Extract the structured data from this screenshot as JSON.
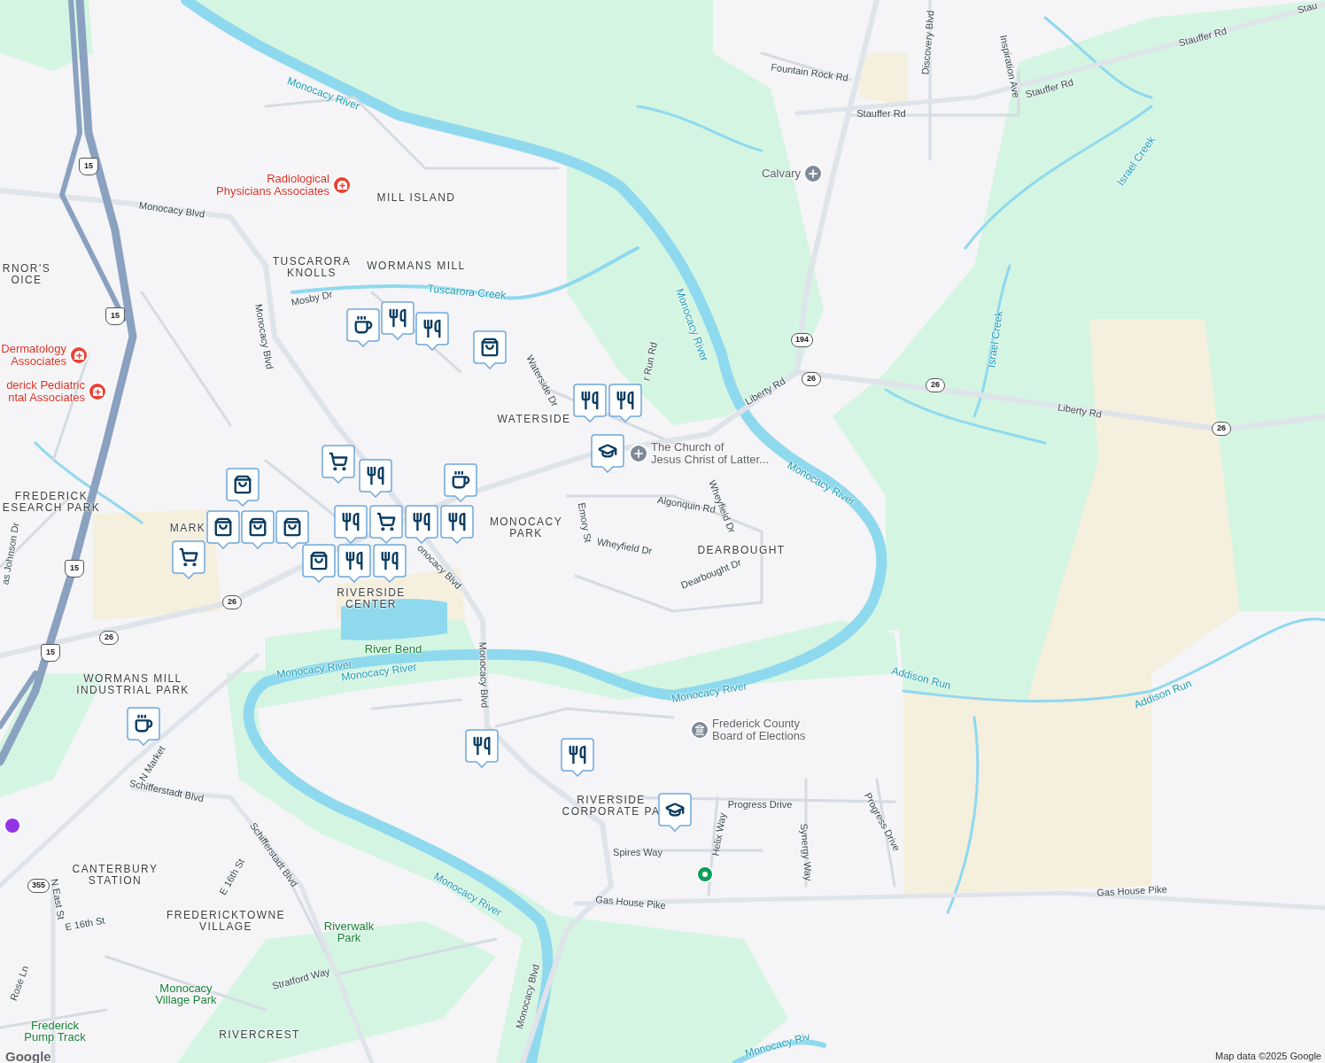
{
  "labels": [
    {
      "kind": "area",
      "text": "MILL ISLAND"
    },
    {
      "kind": "area",
      "text": "RNOR'S\nOICE"
    },
    {
      "kind": "area",
      "text": "TUSCARORA\nKNOLLS"
    },
    {
      "kind": "area",
      "text": "WORMANS MILL"
    },
    {
      "kind": "area",
      "text": "WATERSIDE"
    },
    {
      "kind": "area",
      "text": "FREDERICK\nESEARCH PARK"
    },
    {
      "kind": "area",
      "text": "MARK"
    },
    {
      "kind": "area",
      "text": "MONOCACY\nPARK"
    },
    {
      "kind": "area",
      "text": "DEARBOUGHT"
    },
    {
      "kind": "area",
      "text": "RIVERSIDE\nCENTER"
    },
    {
      "kind": "area",
      "text": "WORMANS MILL\nINDUSTRIAL PARK"
    },
    {
      "kind": "area",
      "text": "RIVERSIDE\nCORPORATE PA"
    },
    {
      "kind": "area",
      "text": "CANTERBURY\nSTATION"
    },
    {
      "kind": "area",
      "text": "FREDERICKTOWNE\nVILLAGE"
    },
    {
      "kind": "area",
      "text": "RIVERCREST"
    },
    {
      "kind": "street",
      "text": "Monocacy Blvd"
    },
    {
      "kind": "street",
      "text": "Fountain Rock Rd"
    },
    {
      "kind": "street",
      "text": "Stauffer Rd"
    },
    {
      "kind": "street",
      "text": "Discovery Blvd"
    },
    {
      "kind": "street",
      "text": "Inspiration Ave"
    },
    {
      "kind": "street",
      "text": "Stauffer Rd"
    },
    {
      "kind": "street",
      "text": "Stauffer Rd"
    },
    {
      "kind": "street",
      "text": "Stau"
    },
    {
      "kind": "street",
      "text": "Mosby Dr"
    },
    {
      "kind": "street",
      "text": "Monocacy Blvd"
    },
    {
      "kind": "street",
      "text": "Waterside Dr"
    },
    {
      "kind": "street",
      "text": "r Run Rd"
    },
    {
      "kind": "street",
      "text": "Liberty Rd"
    },
    {
      "kind": "street",
      "text": "Liberty Rd"
    },
    {
      "kind": "street",
      "text": "Algonquin Rd"
    },
    {
      "kind": "street",
      "text": "Wheyfield Dr"
    },
    {
      "kind": "street",
      "text": "Emory St"
    },
    {
      "kind": "street",
      "text": "Wheyfield Dr"
    },
    {
      "kind": "street",
      "text": "Dearbought Dr"
    },
    {
      "kind": "street",
      "text": "onocacy Blvd"
    },
    {
      "kind": "street",
      "text": "Monocacy Blvd"
    },
    {
      "kind": "street",
      "text": "N Market"
    },
    {
      "kind": "street",
      "text": "Schifferstadt Blvd"
    },
    {
      "kind": "street",
      "text": "Schifferstadt Blvd"
    },
    {
      "kind": "street",
      "text": "E 16th St"
    },
    {
      "kind": "street",
      "text": "N East St"
    },
    {
      "kind": "street",
      "text": "E 16th St"
    },
    {
      "kind": "street",
      "text": "Rose Ln"
    },
    {
      "kind": "street",
      "text": "Stratford Way"
    },
    {
      "kind": "street",
      "text": "Progress Drive"
    },
    {
      "kind": "street",
      "text": "Progress Drive"
    },
    {
      "kind": "street",
      "text": "Helix Way"
    },
    {
      "kind": "street",
      "text": "Synergy Way"
    },
    {
      "kind": "street",
      "text": "Spires Way"
    },
    {
      "kind": "street",
      "text": "Gas House Pike"
    },
    {
      "kind": "street",
      "text": "Gas House Pike"
    },
    {
      "kind": "street",
      "text": "Monocacy Blvd"
    },
    {
      "kind": "street",
      "text": "as Johnson Dr"
    },
    {
      "kind": "water",
      "text": "Monocacy River"
    },
    {
      "kind": "water",
      "text": "Tuscarora Creek"
    },
    {
      "kind": "water",
      "text": "Monocacy River"
    },
    {
      "kind": "water",
      "text": "Israel Creek"
    },
    {
      "kind": "water",
      "text": "Israel Creek"
    },
    {
      "kind": "water",
      "text": "Monocacy River"
    },
    {
      "kind": "water",
      "text": "Monocacy River"
    },
    {
      "kind": "water",
      "text": "Monocacy River"
    },
    {
      "kind": "water",
      "text": "Monocacy River"
    },
    {
      "kind": "water",
      "text": "Addison Run"
    },
    {
      "kind": "water",
      "text": "Addison Run"
    },
    {
      "kind": "water",
      "text": "Monocacy River"
    },
    {
      "kind": "water",
      "text": "Monocacy Riv"
    },
    {
      "kind": "park",
      "text": "River Bend"
    },
    {
      "kind": "park",
      "text": "Riverwalk\nPark"
    },
    {
      "kind": "park",
      "text": "Monocacy\nVillage Park"
    },
    {
      "kind": "park",
      "text": "Frederick\nPump Track"
    }
  ],
  "places": [
    {
      "kind": "medical",
      "text": "Radiological\nPhysicians Associates"
    },
    {
      "kind": "medical",
      "text": "Dermatology\nAssociates"
    },
    {
      "kind": "medical",
      "text": "derick Pediatric\nntal Associates"
    },
    {
      "kind": "church",
      "text": "Calvary"
    },
    {
      "kind": "church",
      "text": "The Church of\nJesus Christ of Latter..."
    },
    {
      "kind": "government",
      "text": "Frederick County\nBoard of Elections"
    }
  ],
  "markers": [
    {
      "kind": "restaurant"
    },
    {
      "kind": "coffee"
    },
    {
      "kind": "restaurant"
    },
    {
      "kind": "shopping"
    },
    {
      "kind": "restaurant"
    },
    {
      "kind": "restaurant"
    },
    {
      "kind": "school"
    },
    {
      "kind": "cart"
    },
    {
      "kind": "restaurant"
    },
    {
      "kind": "coffee"
    },
    {
      "kind": "restaurant"
    },
    {
      "kind": "restaurant"
    },
    {
      "kind": "cart"
    },
    {
      "kind": "restaurant"
    },
    {
      "kind": "shopping"
    },
    {
      "kind": "restaurant"
    },
    {
      "kind": "restaurant"
    },
    {
      "kind": "shopping"
    },
    {
      "kind": "shopping"
    },
    {
      "kind": "shopping"
    },
    {
      "kind": "cart"
    },
    {
      "kind": "shopping"
    },
    {
      "kind": "coffee"
    },
    {
      "kind": "restaurant"
    },
    {
      "kind": "restaurant"
    },
    {
      "kind": "school"
    }
  ],
  "route_shields": [
    {
      "kind": "us",
      "text": "15"
    },
    {
      "kind": "us",
      "text": "15"
    },
    {
      "kind": "us",
      "text": "15"
    },
    {
      "kind": "us",
      "text": "15"
    },
    {
      "kind": "state",
      "text": "194"
    },
    {
      "kind": "state",
      "text": "26"
    },
    {
      "kind": "state",
      "text": "26"
    },
    {
      "kind": "state",
      "text": "26"
    },
    {
      "kind": "state",
      "text": "26"
    },
    {
      "kind": "state",
      "text": "26"
    },
    {
      "kind": "state",
      "text": "355"
    }
  ],
  "logo": "Google",
  "attribution": "Map data ©2025 Google"
}
